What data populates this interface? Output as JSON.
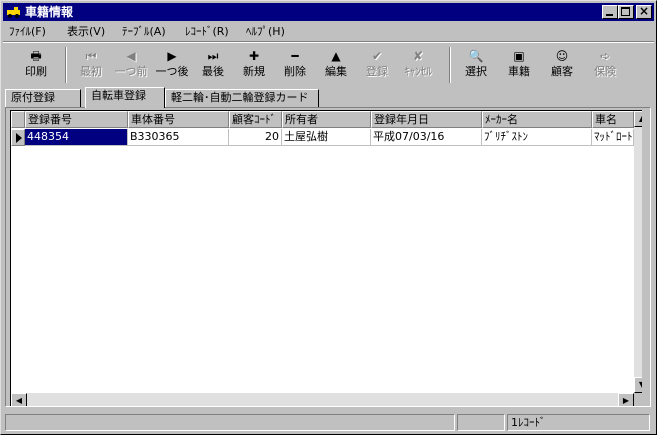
{
  "window": {
    "title": "車籍情報"
  },
  "menu": [
    {
      "label": "ﾌｧｲﾙ(F)"
    },
    {
      "label": "表示(V)"
    },
    {
      "label": "ﾃｰﾌﾞﾙ(A)"
    },
    {
      "label": "ﾚｺｰﾄﾞ(R)"
    },
    {
      "label": "ﾍﾙﾌﾟ(H)"
    }
  ],
  "toolbar": {
    "print": {
      "label": "印刷",
      "icon": "printer-icon",
      "glyph": "🖶"
    },
    "first": {
      "label": "最初",
      "icon": "first-record-icon",
      "glyph": "⏮"
    },
    "prev": {
      "label": "一つ前",
      "icon": "prev-record-icon",
      "glyph": "◀"
    },
    "next": {
      "label": "一つ後",
      "icon": "next-record-icon",
      "glyph": "▶"
    },
    "last": {
      "label": "最後",
      "icon": "last-record-icon",
      "glyph": "⏭"
    },
    "new": {
      "label": "新規",
      "icon": "plus-icon",
      "glyph": "✚"
    },
    "delete": {
      "label": "削除",
      "icon": "minus-icon",
      "glyph": "━"
    },
    "edit": {
      "label": "編集",
      "icon": "edit-arrow-icon",
      "glyph": "▲"
    },
    "save": {
      "label": "登録",
      "icon": "checkmark-icon",
      "glyph": "✔"
    },
    "cancel": {
      "label": "ｷｬﾝｾﾙ",
      "icon": "cancel-x-icon",
      "glyph": "✘"
    },
    "select": {
      "label": "選択",
      "icon": "magnifier-icon",
      "glyph": "🔍"
    },
    "vehicle": {
      "label": "車籍",
      "icon": "vehicle-icon",
      "glyph": "▣"
    },
    "customer": {
      "label": "顧客",
      "icon": "customer-icon",
      "glyph": "☺"
    },
    "insurance": {
      "label": "保険",
      "icon": "insurance-icon",
      "glyph": "➪"
    }
  },
  "tabs": [
    {
      "label": "原付登録",
      "active": false
    },
    {
      "label": "自転車登録",
      "active": true
    },
    {
      "label": "軽二輪･自動二輪登録カード",
      "active": false
    }
  ],
  "grid": {
    "columns": [
      "登録番号",
      "車体番号",
      "顧客ｺｰﾄﾞ",
      "所有者",
      "登録年月日",
      "ﾒｰｶｰ名",
      "車名"
    ],
    "rows": [
      [
        "448354",
        "B330365",
        "20",
        "土屋弘樹",
        "平成07/03/16",
        "ﾌﾞﾘﾁﾞｽﾄﾝ",
        "ﾏｯﾄﾞﾛｰﾄﾞ"
      ]
    ]
  },
  "status": {
    "record_count": "1ﾚｺｰﾄﾞ"
  }
}
